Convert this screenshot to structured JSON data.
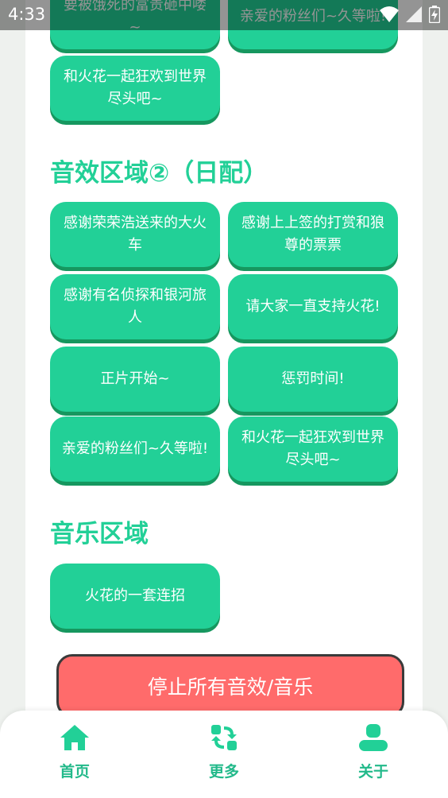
{
  "status_bar": {
    "time": "4:33"
  },
  "colors": {
    "accent": "#22d097",
    "accent_shadow": "#16975f",
    "stop_red": "#ff6b6b"
  },
  "top_section": {
    "partial_buttons": [
      "要被饿死的富贵砸中喽~",
      "亲爱的粉丝们~久等啦!"
    ],
    "button_last": "和火花一起狂欢到世界尽头吧~"
  },
  "section2": {
    "title": "音效区域②（日配）",
    "buttons": [
      "感谢荣荣浩送来的大火车",
      "感谢上上签的打赏和狼尊的票票",
      "感谢有名侦探和银河旅人",
      "请大家一直支持火花!",
      "正片开始~",
      "惩罚时间!",
      "亲爱的粉丝们~久等啦!",
      "和火花一起狂欢到世界尽头吧~"
    ]
  },
  "music": {
    "title": "音乐区域",
    "buttons": [
      "火花的一套连招"
    ]
  },
  "stop_button": "停止所有音效/音乐",
  "nav": {
    "items": [
      {
        "label": "首页",
        "icon": "home-icon"
      },
      {
        "label": "更多",
        "icon": "refresh-icon"
      },
      {
        "label": "关于",
        "icon": "user-icon"
      }
    ]
  }
}
